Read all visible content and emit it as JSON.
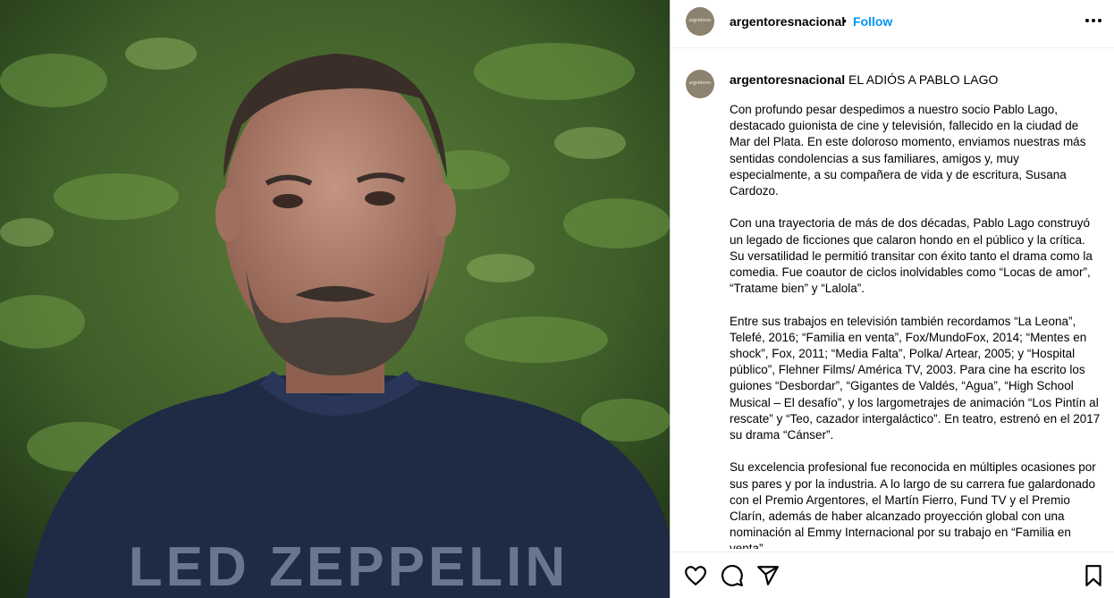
{
  "post": {
    "username": "argentoresnacional",
    "separator": "•",
    "follow_label": "Follow",
    "avatar_text": "argentores",
    "caption_title": "EL ADIÓS A PABLO LAGO",
    "paragraphs": [
      "Con profundo pesar despedimos a nuestro socio Pablo Lago, destacado guionista de cine y televisión, fallecido en la ciudad de Mar del Plata. En este doloroso momento, enviamos nuestras más sentidas condolencias a sus familiares, amigos y, muy especialmente, a su compañera de vida y de escritura, Susana Cardozo.",
      "Con una trayectoria de más de dos décadas, Pablo Lago construyó un legado de ficciones que calaron hondo en el público y la crítica. Su versatilidad le permitió transitar con éxito tanto el drama como la comedia. Fue coautor de ciclos inolvidables como “Locas de amor”, “Tratame bien” y “Lalola”.",
      "Entre sus trabajos en televisión también recordamos “La Leona”, Telefé, 2016; “Familia en venta”, Fox/MundoFox, 2014; “Mentes en shock”, Fox, 2011; “Media Falta”, Polka/ Artear, 2005; y “Hospital público”, Flehner Films/ América TV, 2003. Para cine ha escrito los guiones “Desbordar”, “Gigantes de Valdés, “Agua”, “High School Musical – El desafío”, y los largometrajes de animación “Los Pintín al rescate” y “Teo, cazador intergaláctico”. En teatro, estrenó en el 2017 su drama “Cánser”.",
      "Su excelencia profesional fue reconocida en múltiples ocasiones por sus pares y por la industria. A lo largo de su carrera fue galardonado con el Premio Argentores, el Martín Fierro, Fund TV y el Premio Clarín, además de haber alcanzado proyección global con una nominación al Emmy Internacional por su trabajo en “Familia en venta”."
    ],
    "shirt_text": "LED ZEPPELIN"
  },
  "icons": {
    "more": "more-options-icon",
    "like": "heart-icon",
    "comment": "comment-icon",
    "share": "share-icon",
    "save": "bookmark-icon"
  },
  "colors": {
    "follow": "#0095f6",
    "avatar": "#8d8170",
    "foliage": "#3a5a2a",
    "shirt": "#1f2a44"
  }
}
